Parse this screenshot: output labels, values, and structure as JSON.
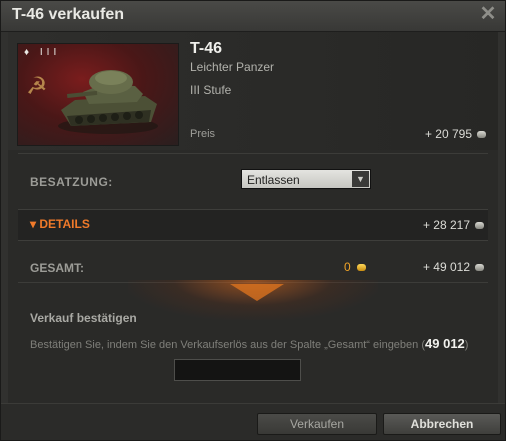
{
  "dialog": {
    "title": "T-46 verkaufen",
    "close_icon": "close-icon"
  },
  "vehicle": {
    "tier_badge": "♦ III",
    "nation_icon": "ussr-hammer-sickle-icon",
    "name": "T-46",
    "class": "Leichter Panzer",
    "tier_label": "III Stufe",
    "price_label": "Preis",
    "price_value": "+ 20 795"
  },
  "crew": {
    "label": "BESATZUNG:",
    "selected": "Entlassen"
  },
  "details": {
    "label": "DETAILS",
    "value": "+ 28 217"
  },
  "total": {
    "label": "GESAMT:",
    "gold_value": "0",
    "credits_value": "+ 49 012"
  },
  "confirm": {
    "title": "Verkauf bestätigen",
    "text_before": "Bestätigen Sie, indem Sie den Verkaufserlös aus der Spalte „Gesamt“ eingeben (",
    "amount": "49 012",
    "text_after": ")",
    "input_value": ""
  },
  "buttons": {
    "sell": "Verkaufen",
    "cancel": "Abbrechen"
  },
  "colors": {
    "accent_orange": "#f07a2a",
    "gold": "#f0a427"
  }
}
